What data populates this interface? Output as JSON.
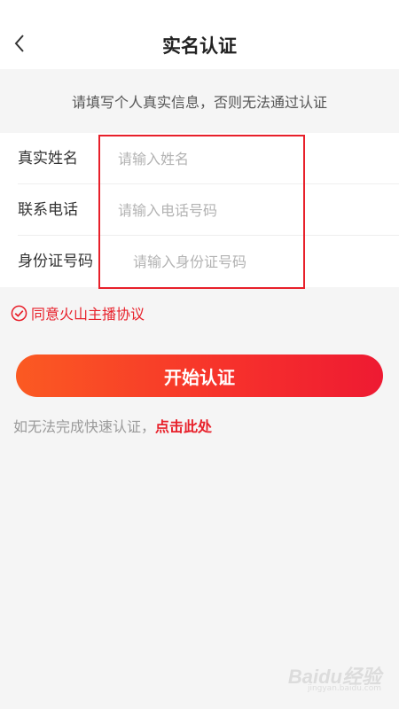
{
  "header": {
    "title": "实名认证",
    "back_icon": "chevron-left-icon"
  },
  "notice": {
    "text": "请填写个人真实信息，否则无法通过认证"
  },
  "form": {
    "name": {
      "label": "真实姓名",
      "placeholder": "请输入姓名",
      "value": ""
    },
    "phone": {
      "label": "联系电话",
      "placeholder": "请输入电话号码",
      "value": ""
    },
    "id_number": {
      "label": "身份证号码",
      "placeholder": "请输入身份证号码",
      "value": ""
    }
  },
  "agreement": {
    "text": "同意火山主播协议",
    "checked": true,
    "icon": "check-circle-icon",
    "color": "#e8202a"
  },
  "start_button": {
    "label": "开始认证",
    "gradient": [
      "#fb5a22",
      "#ee1a32"
    ]
  },
  "fallback": {
    "text": "如无法完成快速认证，",
    "link": "点击此处"
  },
  "watermark": {
    "text": "Baidu经验",
    "sub": "jingyan.baidu.com"
  },
  "colors": {
    "accent": "#e8202a",
    "background": "#f5f5f5"
  }
}
